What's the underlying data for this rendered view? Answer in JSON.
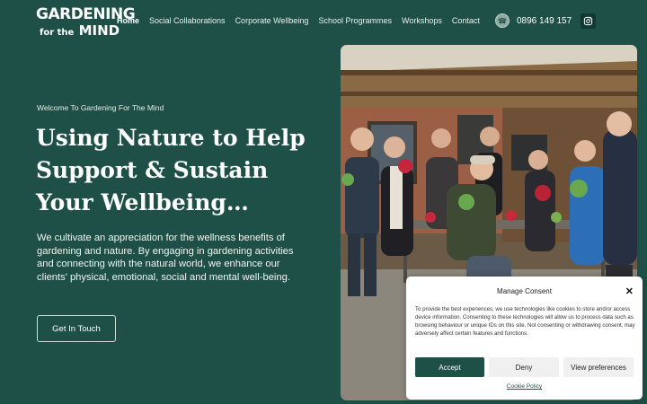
{
  "brand": {
    "line1": "GARDENING",
    "line2_small": "for the",
    "line2_big": "MIND"
  },
  "nav": {
    "items": [
      {
        "label": "Home",
        "active": true
      },
      {
        "label": "Social Collaborations",
        "active": false
      },
      {
        "label": "Corporate Wellbeing",
        "active": false
      },
      {
        "label": "School Programmes",
        "active": false
      },
      {
        "label": "Workshops",
        "active": false
      },
      {
        "label": "Contact",
        "active": false
      }
    ]
  },
  "contact": {
    "phone": "0896 149 157",
    "phone_icon": "phone-icon",
    "social_icon": "instagram-icon"
  },
  "hero": {
    "welcome": "Welcome To Gardening For The Mind",
    "headline_1": "Using Nature to Help",
    "headline_2": "Support & Sustain",
    "headline_3": "Your Wellbeing…",
    "description": "We cultivate an appreciation for the wellness benefits of gardening and nature. By engaging in gardening activities and connecting with the natural world, we enhance our clients' physical, emotional, social and mental well-being.",
    "cta_label": "Get In Touch"
  },
  "consent": {
    "title": "Manage Consent",
    "close_icon": "close-icon",
    "text": "To provide the best experiences, we use technologies like cookies to store and/or access device information. Consenting to these technologies will allow us to process data such as browsing behaviour or unique IDs on this site. Not consenting or withdrawing consent, may adversely affect certain features and functions.",
    "accept_label": "Accept",
    "deny_label": "Deny",
    "prefs_label": "View preferences",
    "policy_link": "Cookie Policy"
  },
  "colors": {
    "background": "#1e5048",
    "accent": "#1e5048",
    "modal": "#ffffff"
  }
}
